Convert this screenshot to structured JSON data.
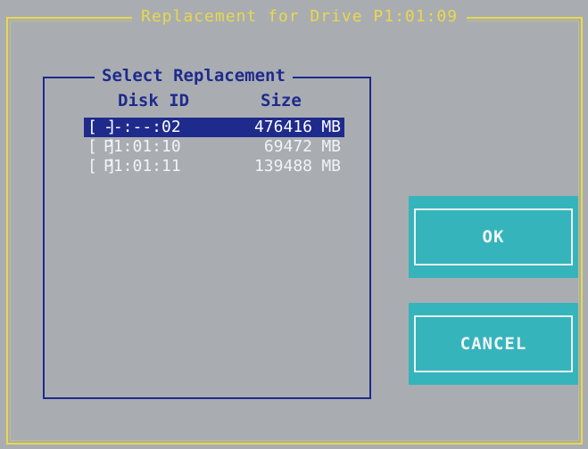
{
  "dialog": {
    "title": "Replacement for Drive P1:01:09"
  },
  "group": {
    "title": "Select Replacement",
    "columns": {
      "disk_id": "Disk ID",
      "size": "Size"
    }
  },
  "disks": [
    {
      "checkbox": "[ ]",
      "id": "--:--:02",
      "size": "476416",
      "unit": "MB",
      "selected": true
    },
    {
      "checkbox": "[ ]",
      "id": "P1:01:10",
      "size": "69472",
      "unit": "MB",
      "selected": false
    },
    {
      "checkbox": "[ ]",
      "id": "P1:01:11",
      "size": "139488",
      "unit": "MB",
      "selected": false
    }
  ],
  "buttons": {
    "ok_label": "OK",
    "cancel_label": "CANCEL"
  },
  "colors": {
    "background": "#a9adb2",
    "frame_yellow": "#e8d84a",
    "frame_blue": "#1e2a8c",
    "selection": "#1e2a8c",
    "button_teal": "#35b4bc"
  }
}
